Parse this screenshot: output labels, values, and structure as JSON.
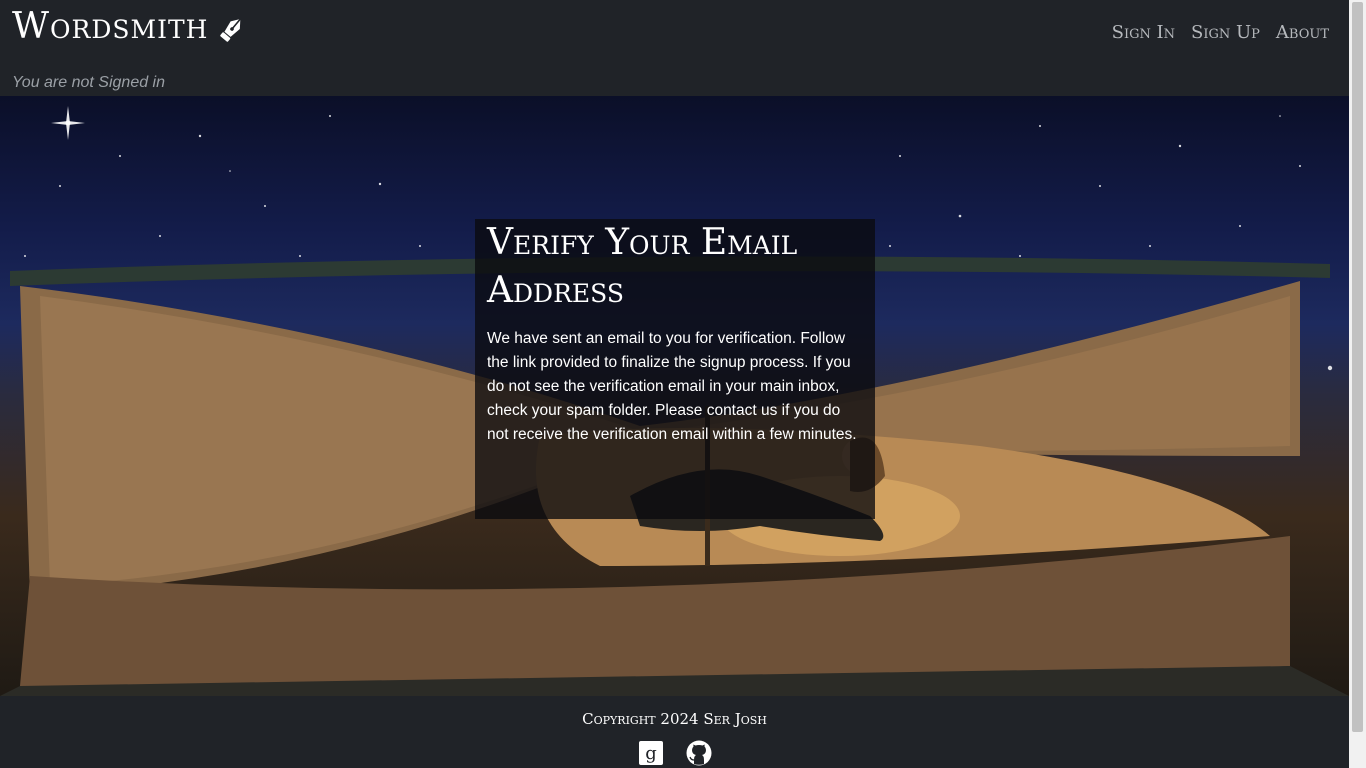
{
  "header": {
    "brand": "Wordsmith",
    "nav": [
      {
        "label": "Sign In"
      },
      {
        "label": "Sign Up"
      },
      {
        "label": "About"
      }
    ],
    "status": "You are not Signed in"
  },
  "card": {
    "title": "Verify Your Email Address",
    "body": "We have sent an email to you for verification. Follow the link provided to finalize the signup process. If you do not see the verification email in your main inbox, check your spam folder. Please contact us if you do not receive the verification email within a few minutes."
  },
  "footer": {
    "copyright": "Copyright 2024 Ser Josh"
  }
}
